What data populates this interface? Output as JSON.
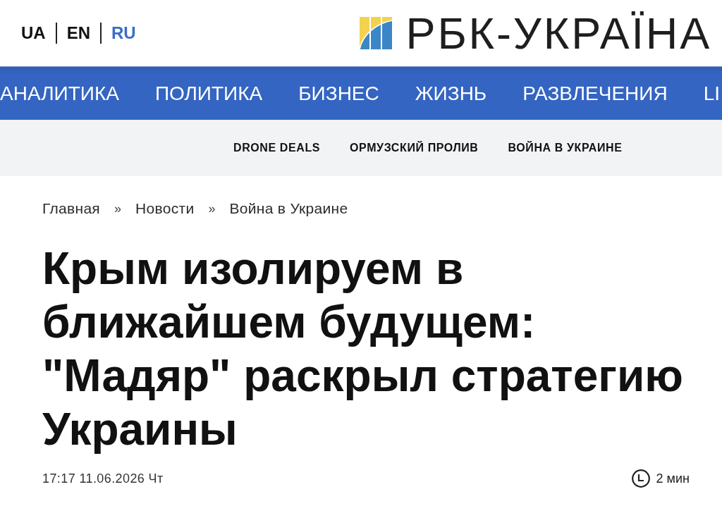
{
  "header": {
    "languages": [
      {
        "label": "UA",
        "selected": false
      },
      {
        "label": "EN",
        "selected": false
      },
      {
        "label": "RU",
        "selected": true
      }
    ],
    "logo": {
      "text": "РБК-УКРАЇНА"
    }
  },
  "main_nav": {
    "items": [
      "АНАЛИТИКА",
      "ПОЛИТИКА",
      "БИЗНЕС",
      "ЖИЗНЬ",
      "РАЗВЛЕЧЕНИЯ",
      "LI"
    ]
  },
  "topics_nav": {
    "items": [
      "DRONE DEALS",
      "ОРМУЗСКИЙ ПРОЛИВ",
      "ВОЙНА В УКРАИНЕ"
    ]
  },
  "breadcrumbs": [
    {
      "kind": "link",
      "label": "Главная"
    },
    {
      "kind": "separator",
      "label": "»"
    },
    {
      "kind": "link",
      "label": "Новости"
    },
    {
      "kind": "separator",
      "label": "»"
    },
    {
      "kind": "link",
      "label": "Война в Украине"
    }
  ],
  "article": {
    "title": "Крым изолируем в ближайшем будущем: \"Мадяр\" раскрыл стратегию Украины",
    "published": "17:17 11.06.2026 Чт",
    "reading_time": "2 мин"
  }
}
